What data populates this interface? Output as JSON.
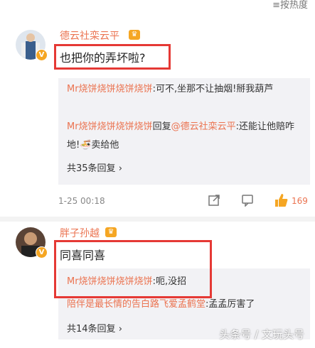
{
  "header": {
    "sort_label": "按热度"
  },
  "comments": [
    {
      "username": "德云社栾云平",
      "text": "也把你的弄坏啦?",
      "replies": [
        {
          "name": "Mr烧饼烧饼烧饼烧饼",
          "text": ":可不,坐那不让抽烟!掰我葫芦"
        },
        {
          "name": "Mr烧饼烧饼烧饼烧饼",
          "reply_word": "回复",
          "mention": "@德云社栾云平",
          "text": ":还能让他赔咋地!",
          "text_after": "卖给他"
        }
      ],
      "more": "共35条回复",
      "time": "1-25 00:18",
      "like_count": "169"
    },
    {
      "username": "胖子孙越",
      "text": "同喜同喜",
      "replies": [
        {
          "name": "Mr烧饼烧饼烧饼烧饼",
          "text": ":呃,没招"
        },
        {
          "name": "陪伴是最长情的告白路飞爱孟鹤堂",
          "text": ":孟孟厉害了"
        }
      ],
      "more": "共14条回复"
    }
  ],
  "watermark": "头条号 / 文玩头号",
  "colors": {
    "username": "#eb7350",
    "highlight": "#e53935",
    "vip": "#f5a623"
  }
}
